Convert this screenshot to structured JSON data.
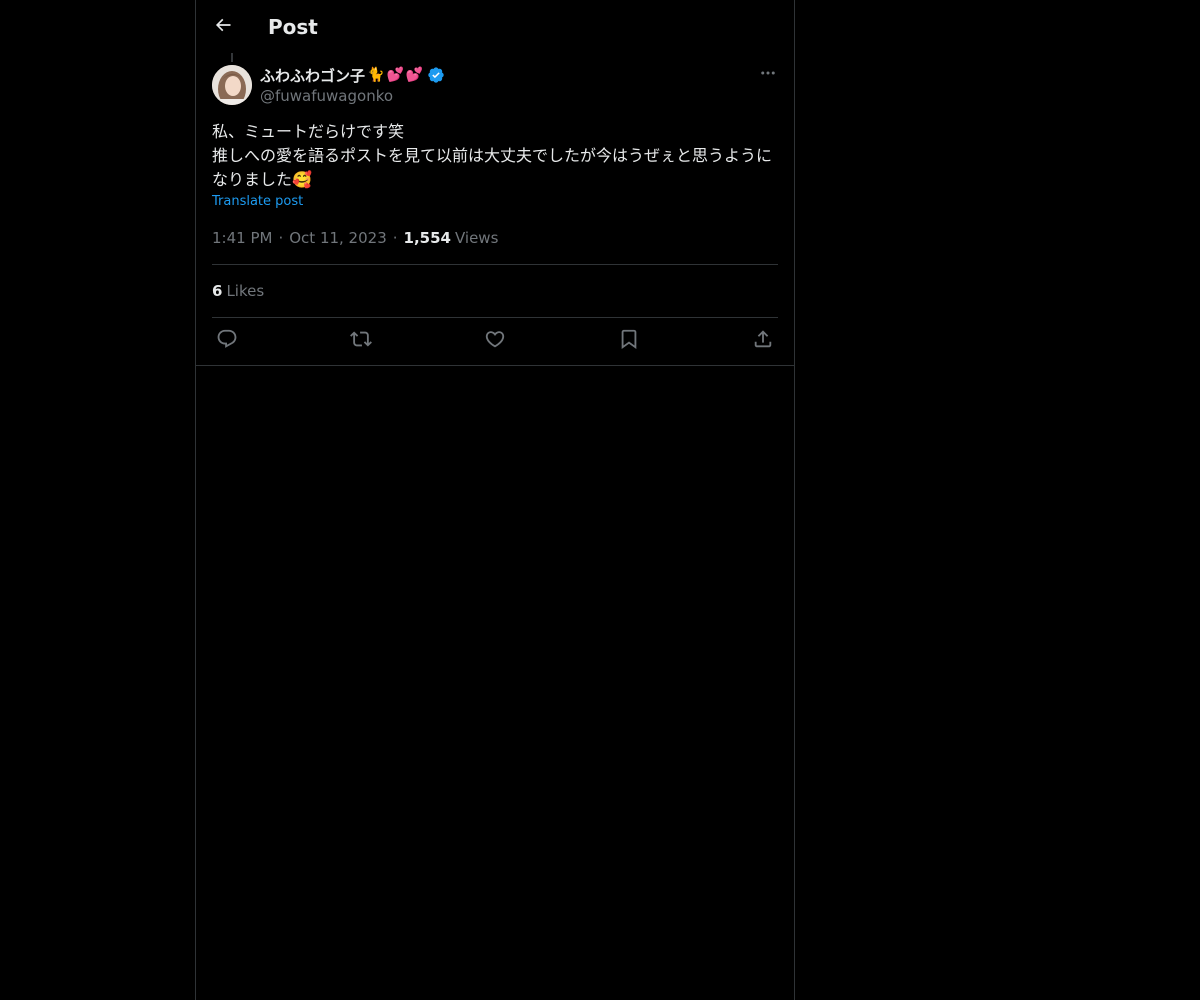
{
  "header": {
    "title": "Post",
    "back_icon": "arrow-left-icon"
  },
  "post": {
    "author": {
      "display_name": "ふわふわゴン子",
      "name_emojis": [
        "🐈",
        "💕",
        "💕"
      ],
      "verified": true,
      "handle": "@fuwafuwagonko"
    },
    "text": "私、ミュートだらけです笑\n推しへの愛を語るポストを見て以前は大丈夫でしたが今はうぜぇと思うようになりました🥰",
    "translate_label": "Translate post",
    "time": "1:41 PM",
    "date": "Oct 11, 2023",
    "views_count": "1,554",
    "views_label": "Views",
    "likes_count": "6",
    "likes_label": "Likes"
  },
  "actions": [
    {
      "name": "reply",
      "icon": "reply-icon"
    },
    {
      "name": "repost",
      "icon": "repost-icon"
    },
    {
      "name": "like",
      "icon": "heart-icon"
    },
    {
      "name": "bookmark",
      "icon": "bookmark-icon"
    },
    {
      "name": "share",
      "icon": "share-icon"
    }
  ],
  "colors": {
    "background": "#000000",
    "text_primary": "#e7e9ea",
    "text_secondary": "#71767b",
    "accent": "#1d9bf0",
    "border": "#2f3336"
  }
}
